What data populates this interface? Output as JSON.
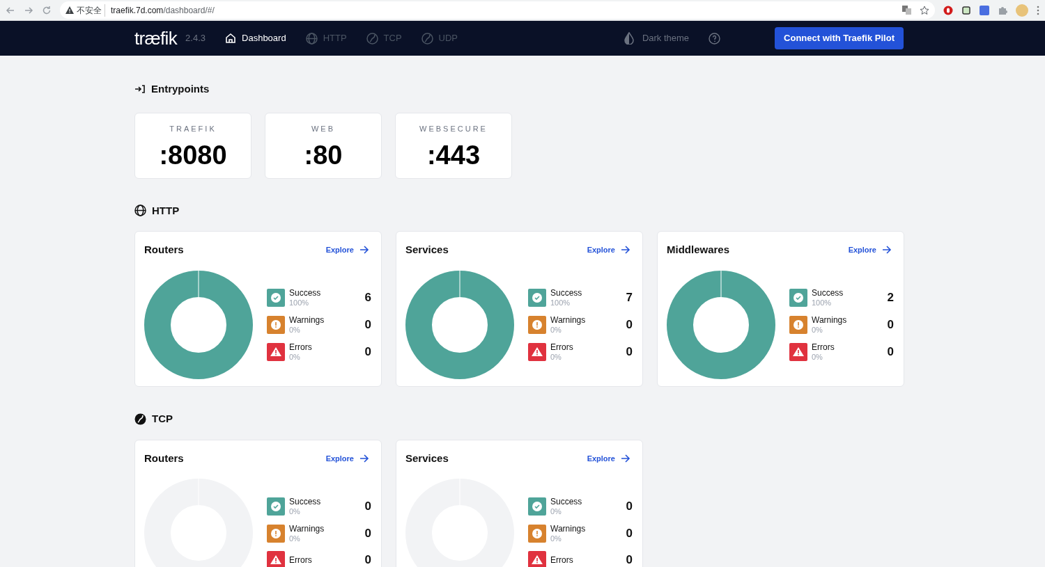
{
  "browser": {
    "security_label": "不安全",
    "url_host": "traefik.7d.com",
    "url_path": "/dashboard/#/"
  },
  "nav": {
    "logo": "træfik",
    "version": "2.4.3",
    "items": [
      {
        "label": "Dashboard",
        "selected": true
      },
      {
        "label": "HTTP",
        "selected": false
      },
      {
        "label": "TCP",
        "selected": false
      },
      {
        "label": "UDP",
        "selected": false
      }
    ],
    "theme_toggle": "Dark theme",
    "pilot_button": "Connect with Traefik Pilot"
  },
  "entrypoints": {
    "title": "Entrypoints",
    "items": [
      {
        "name": "TRAEFIK",
        "port": ":8080"
      },
      {
        "name": "WEB",
        "port": ":80"
      },
      {
        "name": "WEBSECURE",
        "port": ":443"
      }
    ]
  },
  "sections": [
    {
      "title": "HTTP",
      "cards": [
        {
          "title": "Routers",
          "explore": "Explore",
          "stats": [
            {
              "kind": "success",
              "label": "Success",
              "pct": "100%",
              "count": "6"
            },
            {
              "kind": "warning",
              "label": "Warnings",
              "pct": "0%",
              "count": "0"
            },
            {
              "kind": "error",
              "label": "Errors",
              "pct": "0%",
              "count": "0"
            }
          ]
        },
        {
          "title": "Services",
          "explore": "Explore",
          "stats": [
            {
              "kind": "success",
              "label": "Success",
              "pct": "100%",
              "count": "7"
            },
            {
              "kind": "warning",
              "label": "Warnings",
              "pct": "0%",
              "count": "0"
            },
            {
              "kind": "error",
              "label": "Errors",
              "pct": "0%",
              "count": "0"
            }
          ]
        },
        {
          "title": "Middlewares",
          "explore": "Explore",
          "stats": [
            {
              "kind": "success",
              "label": "Success",
              "pct": "100%",
              "count": "2"
            },
            {
              "kind": "warning",
              "label": "Warnings",
              "pct": "0%",
              "count": "0"
            },
            {
              "kind": "error",
              "label": "Errors",
              "pct": "0%",
              "count": "0"
            }
          ]
        }
      ]
    },
    {
      "title": "TCP",
      "cards": [
        {
          "title": "Routers",
          "explore": "Explore",
          "stats": [
            {
              "kind": "success",
              "label": "Success",
              "pct": "0%",
              "count": "0"
            },
            {
              "kind": "warning",
              "label": "Warnings",
              "pct": "0%",
              "count": "0"
            },
            {
              "kind": "error",
              "label": "Errors",
              "count": "0"
            }
          ]
        },
        {
          "title": "Services",
          "explore": "Explore",
          "stats": [
            {
              "kind": "success",
              "label": "Success",
              "pct": "0%",
              "count": "0"
            },
            {
              "kind": "warning",
              "label": "Warnings",
              "pct": "0%",
              "count": "0"
            },
            {
              "kind": "error",
              "label": "Errors",
              "count": "0"
            }
          ]
        }
      ]
    }
  ]
}
